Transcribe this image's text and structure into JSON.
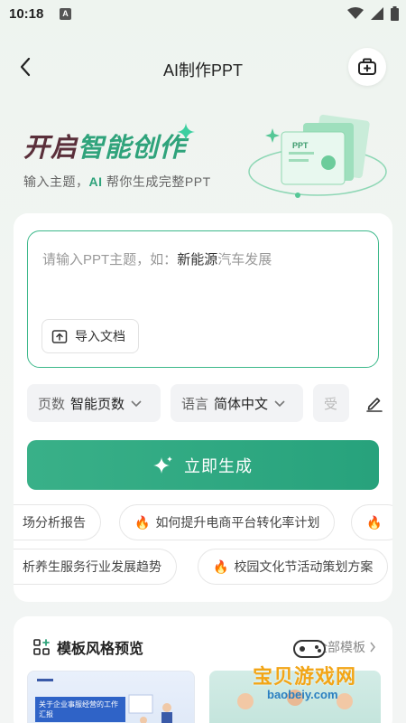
{
  "status_bar": {
    "time": "10:18",
    "notif_letter": "A"
  },
  "header": {
    "title": "AI制作PPT"
  },
  "hero": {
    "title_part1": "开启",
    "title_part2": "智能创作",
    "subtitle_pre": "输入主题，",
    "subtitle_ai": "AI",
    "subtitle_post": " 帮你生成完整PPT",
    "art_label": "PPT"
  },
  "topic": {
    "placeholder_pre": "请输入PPT主题，如：",
    "placeholder_em": "新能源",
    "placeholder_post": "汽车发展",
    "import_label": "导入文档"
  },
  "options": {
    "pages_key": "页数",
    "pages_value": "智能页数",
    "lang_key": "语言",
    "lang_value": "简体中文",
    "audience_key": "受"
  },
  "generate_label": "立即生成",
  "suggestions_row1": [
    "场分析报告",
    "如何提升电商平台转化率计划"
  ],
  "suggestions_row2": [
    "析养生服务行业发展趋势",
    "校园文化节活动策划方案"
  ],
  "templates": {
    "title": "模板风格预览",
    "all_label": "全部模板",
    "thumb1_text": "关于企业事服经营的工作汇报"
  },
  "watermark": {
    "text": "宝贝游戏网",
    "url": "baobeiy.com"
  },
  "colors": {
    "accent": "#2fa37b",
    "brand_dark": "#5a2f3a",
    "fire": "#f05a28"
  }
}
